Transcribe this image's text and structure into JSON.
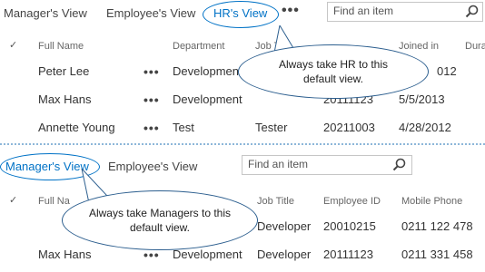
{
  "top": {
    "views": [
      "Manager's View",
      "Employee's View",
      "HR's View"
    ],
    "active_view": "HR's View",
    "more_label": "•••",
    "search_placeholder": "Find an item",
    "columns": [
      "Full Name",
      "Department",
      "Job Ti",
      "Joined in",
      "Dura"
    ],
    "rows": [
      {
        "name": "Peter Lee",
        "department": "Development",
        "job": "",
        "id": "",
        "joined": "012"
      },
      {
        "name": "Max Hans",
        "department": "Development",
        "job": "",
        "id": "20111123",
        "joined": "5/5/2013"
      },
      {
        "name": "Annette Young",
        "department": "Test",
        "job": "Tester",
        "id": "20211003",
        "joined": "4/28/2012"
      }
    ],
    "callout": "Always take HR to this default view."
  },
  "bottom": {
    "views": [
      "Manager's View",
      "Employee's View"
    ],
    "active_view": "Manager's View",
    "search_placeholder": "Find an item",
    "columns": [
      "Full Na",
      "Job Title",
      "Employee ID",
      "Mobile Phone"
    ],
    "rows": [
      {
        "name": "",
        "department": "",
        "job": "Developer",
        "id": "20010215",
        "phone": "0211 122 478"
      },
      {
        "name": "Max Hans",
        "department": "Development",
        "job": "Developer",
        "id": "20111123",
        "phone": "0211 331 458"
      }
    ],
    "callout": "Always take Managers to this default view."
  },
  "check_symbol": "✓",
  "row_more_label": "•••",
  "colors": {
    "accent": "#0072c6",
    "divider": "#8db7d9",
    "callout_border": "#2d5f8f"
  }
}
